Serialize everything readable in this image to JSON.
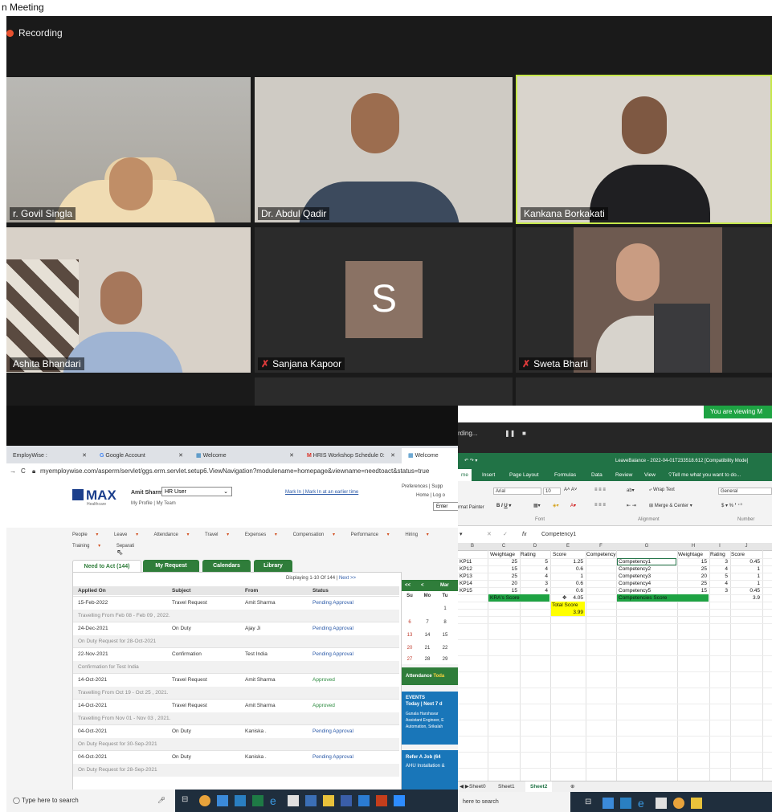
{
  "meeting": {
    "title": "n Meeting",
    "recording_label": "Recording",
    "participants": [
      {
        "name": "r. Govil Singla"
      },
      {
        "name": "Dr. Abdul Qadir"
      },
      {
        "name": "Kankana Borkakati"
      },
      {
        "name": "Ashita Bhandari"
      },
      {
        "name": "Sanjana Kapoor",
        "avatar_letter": "S",
        "muted": true
      },
      {
        "name": "Sweta Bharti",
        "muted": true
      }
    ]
  },
  "browser": {
    "tabs": [
      {
        "label": "EmployWise :"
      },
      {
        "label": "Google Account"
      },
      {
        "label": "Welcome"
      },
      {
        "label": "HRIS Workshop Schedule 0:"
      },
      {
        "label": "Welcome"
      }
    ],
    "url": "myemploywise.com/asperm/servlet/ggs.erm.servlet.setup6.ViewNavigation?modulename=homepage&viewname=needtoact&status=true",
    "app": {
      "logo": "MAX",
      "logo_sub": "Healthcare",
      "user_name": "Amit Sharma,",
      "user_role": "HR User",
      "user_links": "My Profile | My Team",
      "mark_in": "Mark In | Mark In at an earlier time",
      "top_links": [
        "Preferences | Supp",
        "Home | Log o"
      ],
      "enter_label": "Enter",
      "menu": [
        "People",
        "Leave",
        "Attendance",
        "Travel",
        "Expenses",
        "Compensation",
        "Performance",
        "Hiring",
        "Training",
        "Separati"
      ],
      "subtabs": [
        "Need to Act (144)",
        "My Request",
        "Calendars",
        "Library"
      ],
      "displaying": "Displaying 1-10 Of 144 |",
      "next": "Next >>",
      "columns": [
        "Applied On",
        "Subject",
        "From",
        "Status"
      ],
      "rows": [
        {
          "date": "15-Feb-2022",
          "subject": "Travel Request",
          "from": "Amit Sharma",
          "status": "Pending Approval",
          "detail": "Travelling From Feb 08 - Feb 09 , 2022."
        },
        {
          "date": "24-Dec-2021",
          "subject": "On Duty",
          "from": "Ajay Ji",
          "status": "Pending Approval",
          "detail": "On Duty Request for 28-Oct-2021"
        },
        {
          "date": "22-Nov-2021",
          "subject": "Confirmation",
          "from": "Test India",
          "status": "Pending Approval",
          "detail": "Confirmation for Test India"
        },
        {
          "date": "14-Oct-2021",
          "subject": "Travel Request",
          "from": "Amit Sharma",
          "status": "Approved",
          "detail": "Travelling From Oct 19 - Oct 25 , 2021."
        },
        {
          "date": "14-Oct-2021",
          "subject": "Travel Request",
          "from": "Amit Sharma",
          "status": "Approved",
          "detail": "Travelling From Nov 01 - Nov 03 , 2021."
        },
        {
          "date": "04-Oct-2021",
          "subject": "On Duty",
          "from": "Kaniska .",
          "status": "Pending Approval",
          "detail": "On Duty Request for 30-Sep-2021"
        },
        {
          "date": "04-Oct-2021",
          "subject": "On Duty",
          "from": "Kaniska .",
          "status": "Pending Approval",
          "detail": "On Duty Request for 28-Sep-2021"
        }
      ],
      "calendar": {
        "nav": [
          "<<",
          "<",
          "Mar"
        ],
        "days": [
          "Su",
          "Mo",
          "Tu"
        ],
        "weeks": [
          [
            "",
            "",
            "1"
          ],
          [
            "6",
            "7",
            "8"
          ],
          [
            "13",
            "14",
            "15"
          ],
          [
            "20",
            "21",
            "22"
          ],
          [
            "27",
            "28",
            "29"
          ]
        ]
      },
      "attendance": "Attendance",
      "attendance_y": "Toda",
      "events_title": "EVENTS",
      "events_sub": "Today | Next 7 d",
      "events_text": [
        "Gunala Harshavar",
        "Assistant Engineer, E",
        "Automation, Srikalah"
      ],
      "refer_title": "Refer A Job (64",
      "refer_text": "AHU Installation &"
    },
    "search_placeholder": "Type here to search"
  },
  "excel": {
    "viewing_banner": "You are viewing M",
    "recording_label": "rding...",
    "title": "LeaveBalance - 2022-04-01T233518.612 [Compatibility Mode]",
    "ribbon_tabs": [
      "me",
      "Insert",
      "Page Layout",
      "Formulas",
      "Data",
      "Review",
      "View",
      "Tell me what you want to do..."
    ],
    "font_name": "Arial",
    "font_size": "10",
    "wrap_text": "Wrap Text",
    "merge_center": "Merge & Center",
    "number_format": "General",
    "format_painter": "rmat Painter",
    "groups": [
      "Font",
      "Alignment",
      "Number"
    ],
    "formula_value": "Competency1",
    "fx": "fx",
    "col_headers": [
      "B",
      "C",
      "D",
      "E",
      "F",
      "G",
      "H",
      "I",
      "J"
    ],
    "header_row": [
      "Weightage",
      "Rating",
      "Score",
      "Competency",
      "",
      "Weightage",
      "Rating",
      "Score"
    ],
    "kra_rows": [
      [
        "KP11",
        "25",
        "5",
        "1.25",
        "Competency1",
        "15",
        "3",
        "0.45"
      ],
      [
        "KP12",
        "15",
        "4",
        "0.6",
        "Competency2",
        "25",
        "4",
        "1"
      ],
      [
        "KP13",
        "25",
        "4",
        "1",
        "Competency3",
        "20",
        "5",
        "1"
      ],
      [
        "KP14",
        "20",
        "3",
        "0.6",
        "Competency4",
        "25",
        "4",
        "1"
      ],
      [
        "KP15",
        "15",
        "4",
        "0.6",
        "Competency5",
        "15",
        "3",
        "0.45"
      ]
    ],
    "kra_score_label": "KRA's Score",
    "kra_score": "4.05",
    "comp_score_label": "Competencies Score",
    "comp_score": "3.9",
    "total_label": "Total Score",
    "total_score": "3.99",
    "sheets": [
      "Sheet0",
      "Sheet1",
      "Sheet2"
    ],
    "search_placeholder": "here to search",
    "colors": {
      "excel_green": "#217346",
      "highlight_green": "#1ea343",
      "yellow": "#ffff00"
    }
  }
}
